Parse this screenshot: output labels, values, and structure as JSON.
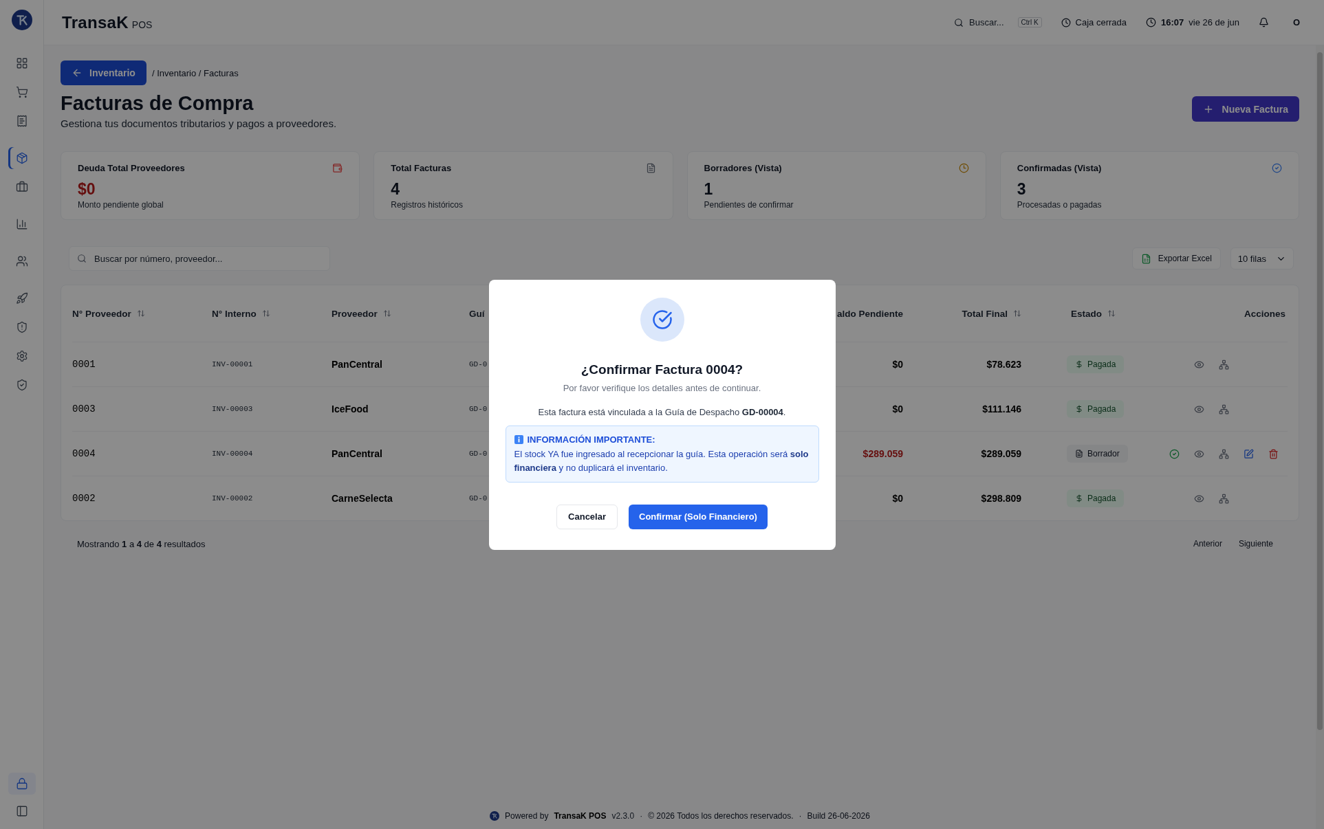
{
  "topbar": {
    "brand": "TransaK",
    "brand_suffix": "POS",
    "search": {
      "placeholder": "Buscar...",
      "shortcut": "Ctrl K"
    },
    "register_status": "Caja cerrada",
    "time": "16:07",
    "date": "vie 26 de jun",
    "avatar": "O"
  },
  "sidebar": {
    "groups": [
      [
        {
          "kind": "dashboard",
          "selected": false
        },
        {
          "kind": "cart",
          "selected": false
        },
        {
          "kind": "receipt",
          "selected": false
        }
      ],
      [
        {
          "kind": "package",
          "selected": true
        },
        {
          "kind": "briefcase",
          "selected": false
        }
      ],
      [
        {
          "kind": "chart",
          "selected": false
        }
      ],
      [
        {
          "kind": "users",
          "selected": false
        }
      ],
      [
        {
          "kind": "rocket",
          "selected": false
        },
        {
          "kind": "shield-alert",
          "selected": false
        },
        {
          "kind": "settings",
          "selected": false
        },
        {
          "kind": "shield-check",
          "selected": false
        }
      ]
    ],
    "bottom": [
      {
        "kind": "lock",
        "selected": true
      },
      {
        "kind": "panel",
        "selected": false
      }
    ]
  },
  "breadcrumb": {
    "back": "Inventario",
    "path": "/ Inventario / Facturas"
  },
  "header": {
    "title": "Facturas de Compra",
    "subtitle": "Gestiona tus documentos tributarios y pagos a proveedores.",
    "action": "Nueva Factura"
  },
  "stats": [
    {
      "title": "Deuda Total Proveedores",
      "value": "$0",
      "caption": "Monto pendiente global",
      "kind": "wallet",
      "alert": true
    },
    {
      "title": "Total Facturas",
      "value": "4",
      "caption": "Registros históricos",
      "kind": "file",
      "alert": false
    },
    {
      "title": "Borradores (Vista)",
      "value": "1",
      "caption": "Pendientes de confirmar",
      "kind": "clock",
      "alert": false
    },
    {
      "title": "Confirmadas (Vista)",
      "value": "3",
      "caption": "Procesadas o pagadas",
      "kind": "check",
      "alert": false
    }
  ],
  "toolbar": {
    "search_placeholder": "Buscar por número, proveedor...",
    "export": "Exportar Excel",
    "page_size": "10 filas"
  },
  "table": {
    "columns": [
      {
        "label": "N° Proveedor",
        "sortable": true
      },
      {
        "label": "N° Interno",
        "sortable": true
      },
      {
        "label": "Proveedor",
        "sortable": true
      },
      {
        "label": "Guí",
        "sortable": false
      },
      {
        "label": "aldo Pendiente",
        "sortable": false
      },
      {
        "label": "Total Final",
        "sortable": true
      },
      {
        "label": "Estado",
        "sortable": true
      },
      {
        "label": "Acciones",
        "sortable": false
      }
    ],
    "rows": [
      {
        "supplier_no": "0001",
        "internal_no": "INV-00001",
        "supplier": "PanCentral",
        "guide": "GD-0",
        "balance": "$0",
        "balance_pending": false,
        "total": "$78.623",
        "status": {
          "kind": "paid",
          "label": "Pagada"
        },
        "actions": [
          {
            "kind": "view"
          },
          {
            "kind": "tree"
          }
        ]
      },
      {
        "supplier_no": "0003",
        "internal_no": "INV-00003",
        "supplier": "IceFood",
        "guide": "GD-0",
        "balance": "$0",
        "balance_pending": false,
        "total": "$111.146",
        "status": {
          "kind": "paid",
          "label": "Pagada"
        },
        "actions": [
          {
            "kind": "view"
          },
          {
            "kind": "tree"
          }
        ]
      },
      {
        "supplier_no": "0004",
        "internal_no": "INV-00004",
        "supplier": "PanCentral",
        "guide": "GD-0",
        "balance": "$289.059",
        "balance_pending": true,
        "total": "$289.059",
        "status": {
          "kind": "draft",
          "label": "Borrador"
        },
        "actions": [
          {
            "kind": "confirm"
          },
          {
            "kind": "view"
          },
          {
            "kind": "tree"
          },
          {
            "kind": "edit"
          },
          {
            "kind": "delete"
          }
        ]
      },
      {
        "supplier_no": "0002",
        "internal_no": "INV-00002",
        "supplier": "CarneSelecta",
        "guide": "GD-0",
        "balance": "$0",
        "balance_pending": false,
        "total": "$298.809",
        "status": {
          "kind": "paid",
          "label": "Pagada"
        },
        "actions": [
          {
            "kind": "view"
          },
          {
            "kind": "tree"
          }
        ]
      }
    ]
  },
  "pagination": {
    "summary": "Mostrando **1** a **4** de **4** resultados",
    "previous": "Anterior",
    "next": "Siguiente"
  },
  "footer": {
    "powered": "Powered by",
    "brand": "TransaK POS",
    "version": "v2.3.0",
    "separator": "·",
    "copyright": "© 2026 Todos los derechos reservados.",
    "separator_2": "·",
    "build": "Build 26-06-2026"
  },
  "dialog": {
    "title": "¿Confirmar Factura 0004?",
    "subtitle": "Por favor verifique los detalles antes de continuar.",
    "message": "Esta factura está vinculada a la Guía de Despacho **GD-00004**.",
    "notice": {
      "title": "INFORMACIÓN IMPORTANTE:",
      "body": "El stock YA fue ingresado al recepcionar la guía. Esta operación será **solo financiera** y no duplicará el inventario."
    },
    "cancel": "Cancelar",
    "confirm": "Confirmar (Solo Financiero)"
  }
}
